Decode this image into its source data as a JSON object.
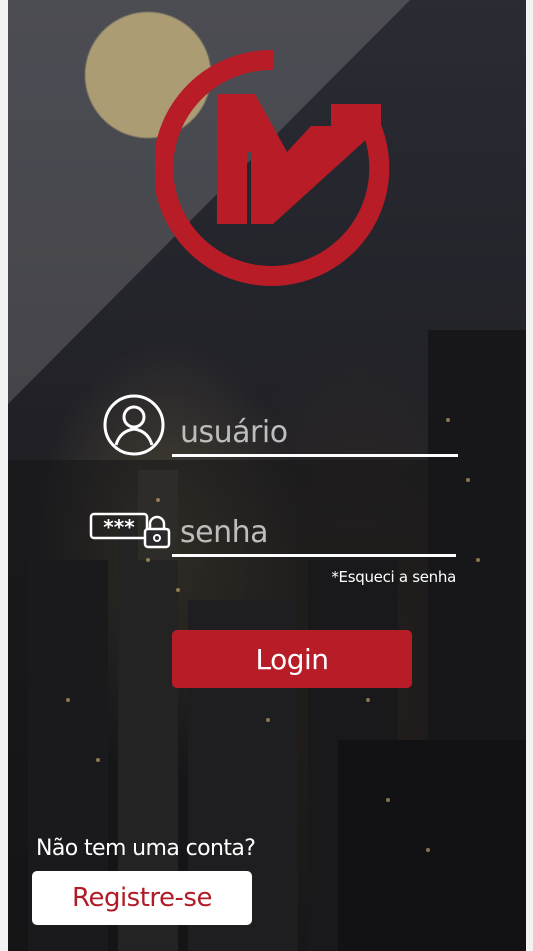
{
  "login": {
    "username_placeholder": "usuário",
    "username_value": "",
    "password_placeholder": "senha",
    "password_value": "",
    "password_icon_text": "***",
    "forgot_password": "*Esqueci a senha",
    "login_button": "Login"
  },
  "signup": {
    "prompt": "Não tem uma conta?",
    "register_button": "Registre-se"
  },
  "icons": {
    "logo": "brand-logo",
    "user": "user-icon",
    "password": "password-lock-icon"
  },
  "colors": {
    "accent": "#b81c27",
    "register_text": "#b01c26",
    "text_light": "#ffffff",
    "placeholder": "#bdbdbd"
  }
}
